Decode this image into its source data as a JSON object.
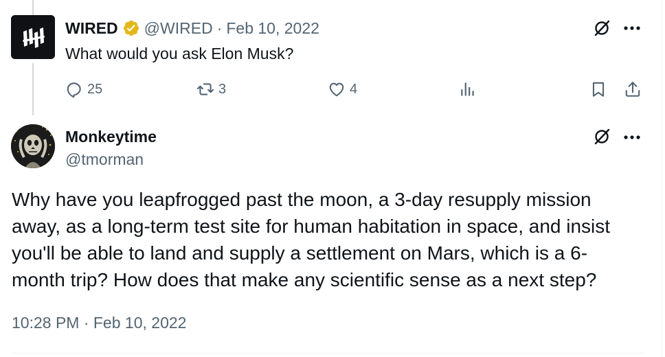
{
  "parent_tweet": {
    "author_name": "WIRED",
    "verified": true,
    "handle": "@WIRED",
    "separator": "·",
    "date": "Feb 10, 2022",
    "text": "What would you ask Elon Musk?",
    "stats": {
      "replies": "25",
      "reposts": "3",
      "likes": "4"
    }
  },
  "reply_tweet": {
    "author_name": "Monkeytime",
    "handle": "@tmorman",
    "text_lines": [
      "Why have you leapfrogged past the moon, a 3-day resupply mission",
      "away, as a long-term test site for human habitation in space, and insist",
      "you'll be able to land and supply a settlement on Mars, which is a 6-",
      "month trip? How does that make any scientific sense as a next step?"
    ],
    "timestamp": "10:28 PM · Feb 10, 2022"
  },
  "icons": {
    "grok": "grok-icon",
    "more": "more-icon",
    "reply": "reply-icon",
    "repost": "repost-icon",
    "like": "heart-icon",
    "views": "views-icon",
    "bookmark": "bookmark-icon",
    "share": "share-icon",
    "verified": "verified-badge-icon"
  },
  "colors": {
    "text": "#0f1419",
    "secondary": "#536471",
    "verified_gold": "#e2b719",
    "divider": "#eff3f4",
    "thread_line": "#cfd9de"
  }
}
